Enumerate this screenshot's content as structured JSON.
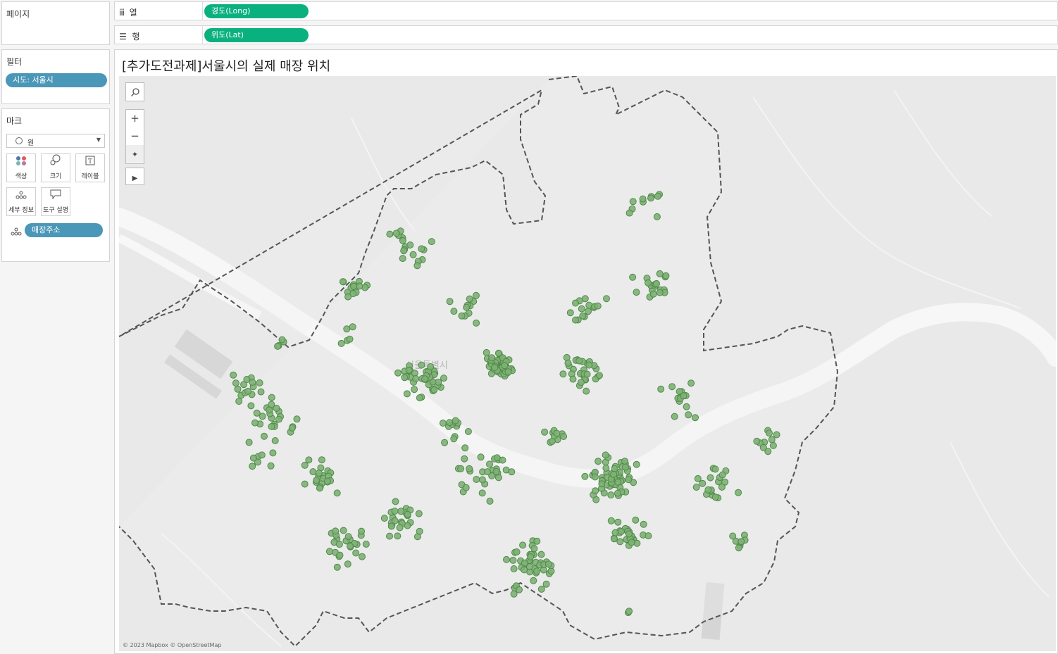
{
  "pages_panel": {
    "title": "페이지"
  },
  "columns_shelf": {
    "icon": "columns-icon",
    "label": "열",
    "pill": "경도(Long)"
  },
  "rows_shelf": {
    "icon": "rows-icon",
    "label": "행",
    "pill": "위도(Lat)"
  },
  "filters_panel": {
    "title": "필터",
    "pill": "시도: 서울시"
  },
  "marks_panel": {
    "title": "마크",
    "mark_type": "원",
    "cards": [
      {
        "name": "color",
        "label": "색상",
        "icon": "color-icon"
      },
      {
        "name": "size",
        "label": "크기",
        "icon": "size-icon"
      },
      {
        "name": "label",
        "label": "레이블",
        "icon": "label-icon"
      },
      {
        "name": "detail",
        "label": "세부 정보",
        "icon": "detail-icon"
      },
      {
        "name": "tooltip",
        "label": "도구 설명",
        "icon": "tooltip-icon"
      }
    ],
    "detail_pill": "매장주소"
  },
  "view": {
    "title": "[추가도전과제]서울시의 실제 매장 위치",
    "city_label": "서울특별시",
    "attribution": "© 2023 Mapbox © OpenStreetMap"
  },
  "colors": {
    "mark_fill": "#7fb176",
    "mark_stroke": "#4f8a4a",
    "pill_green": "#0bb07f",
    "pill_blue": "#4b97b8"
  },
  "chart_data": {
    "type": "scatter",
    "title": "[추가도전과제]서울시의 실제 매장 위치",
    "x_field": "경도(Long)",
    "y_field": "위도(Lat)",
    "mark": "circle",
    "points_approx_count": 430
  }
}
